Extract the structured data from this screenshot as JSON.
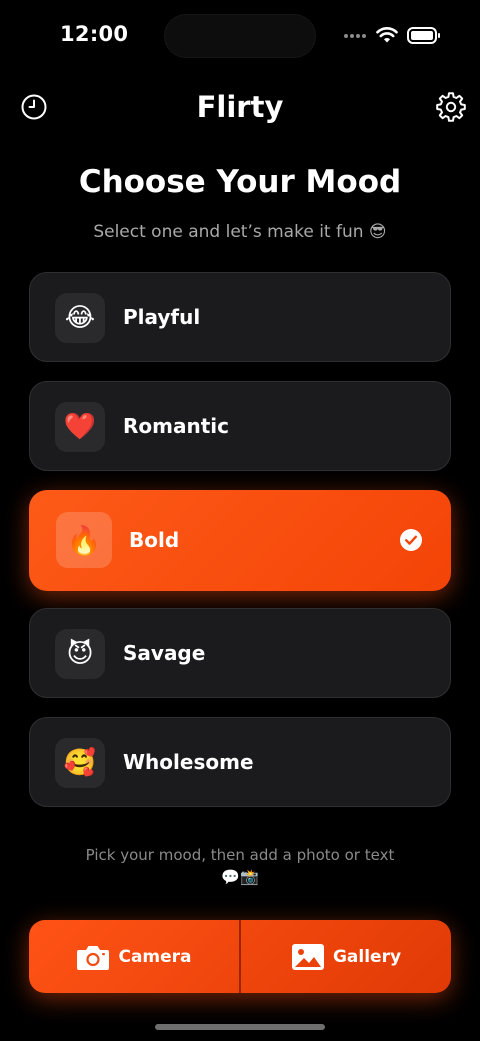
{
  "status_bar": {
    "time": "12:00"
  },
  "header": {
    "title": "Flirty",
    "history_icon": "history-clock-icon",
    "settings_icon": "gear-icon"
  },
  "main": {
    "heading": "Choose Your Mood",
    "subtitle": "Select one and let’s make it fun 😎"
  },
  "moods": [
    {
      "emoji": "😂",
      "label": "Playful",
      "selected": false
    },
    {
      "emoji": "❤️",
      "label": "Romantic",
      "selected": false
    },
    {
      "emoji": "🔥",
      "label": "Bold",
      "selected": true
    },
    {
      "emoji": "😈",
      "label": "Savage",
      "selected": false
    },
    {
      "emoji": "🥰",
      "label": "Wholesome",
      "selected": false
    }
  ],
  "hint": {
    "line1": "Pick your mood, then add a photo or text",
    "line2": "💬📸"
  },
  "actions": {
    "camera_label": "Camera",
    "gallery_label": "Gallery"
  },
  "colors": {
    "accent": "#FD5A18",
    "card_bg": "#1B1B1D",
    "background": "#000000"
  }
}
